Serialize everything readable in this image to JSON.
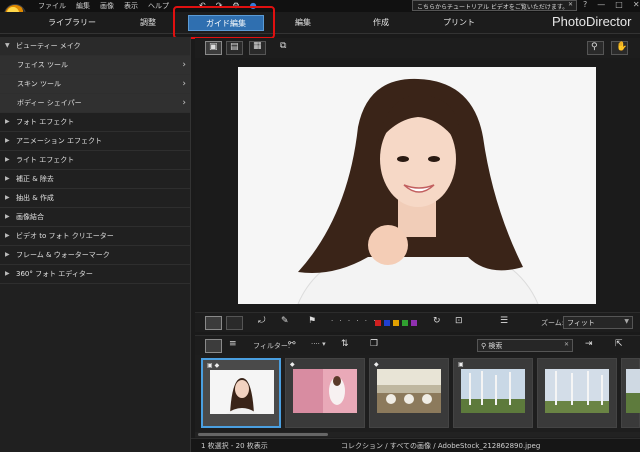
{
  "menu": {
    "items": [
      "ファイル",
      "編集",
      "画像",
      "表示",
      "ヘルプ"
    ],
    "notification": "こちらからチュートリアル ビデオをご覧いただけます。",
    "window_controls": [
      "?",
      "—",
      "□",
      "✕"
    ]
  },
  "tabs": [
    {
      "label": "ライブラリー",
      "active": false
    },
    {
      "label": "調整",
      "active": false
    },
    {
      "label": "ガイド編集",
      "active": true
    },
    {
      "label": "編集",
      "active": false
    },
    {
      "label": "作成",
      "active": false
    },
    {
      "label": "プリント",
      "active": false
    }
  ],
  "brand": "PhotoDirector",
  "sidebar": {
    "items": [
      {
        "label": "ビューティー メイク",
        "expanded": true
      },
      {
        "label": "フェイス ツール",
        "sub": true
      },
      {
        "label": "スキン ツール",
        "sub": true
      },
      {
        "label": "ボディー シェイパー",
        "sub": true
      },
      {
        "label": "フォト エフェクト"
      },
      {
        "label": "アニメーション エフェクト"
      },
      {
        "label": "ライト エフェクト"
      },
      {
        "label": "補正 & 除去"
      },
      {
        "label": "抽出 & 作成"
      },
      {
        "label": "画像結合"
      },
      {
        "label": "ビデオ to フォト クリエーター"
      },
      {
        "label": "フレーム & ウォーターマーク"
      },
      {
        "label": "360° フォト エディター"
      }
    ]
  },
  "toolbar": {
    "zoom_label": "ズーム:",
    "zoom_value": "フィット",
    "filter_label": "フィルター:",
    "search_placeholder": "検索",
    "color_labels": [
      "#d02020",
      "#2040d0",
      "#e0a000",
      "#30a030",
      "#9030b0"
    ]
  },
  "filmstrip": {
    "thumbnails": [
      {
        "type": "portrait",
        "selected": true
      },
      {
        "type": "pink-portrait",
        "selected": false
      },
      {
        "type": "banquet-hall",
        "selected": false
      },
      {
        "type": "birch-forest",
        "selected": false
      },
      {
        "type": "birch-forest-2",
        "selected": false
      },
      {
        "type": "partial",
        "selected": false
      }
    ]
  },
  "status": {
    "selection": "1 枚選択 - 20 枚表示",
    "path": "コレクション / すべての画像 / AdobeStock_212862890.jpeg"
  },
  "colors": {
    "accent_tab": "#2f6fb0",
    "highlight_box": "#e01010",
    "selection_border": "#4a9fe0"
  }
}
